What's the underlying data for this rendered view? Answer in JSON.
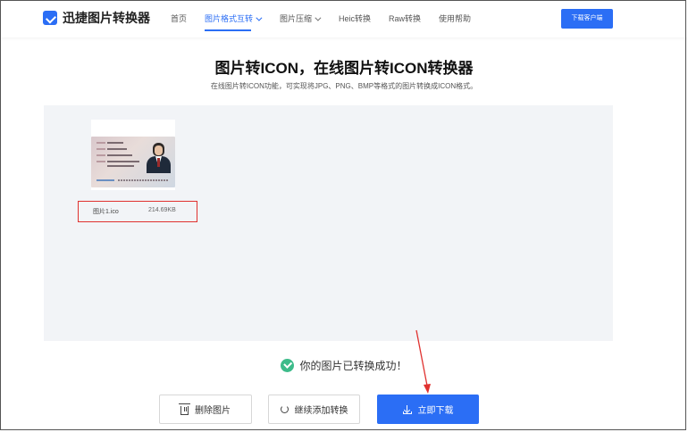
{
  "header": {
    "logo_text": "迅捷图片转换器",
    "nav": [
      {
        "label": "首页"
      },
      {
        "label": "图片格式互转"
      },
      {
        "label": "图片压缩"
      },
      {
        "label": "Heic转换"
      },
      {
        "label": "Raw转换"
      },
      {
        "label": "使用帮助"
      }
    ],
    "download_client": "下载客户端"
  },
  "main": {
    "title": "图片转ICON，在线图片转ICON转换器",
    "subtitle": "在线图片转ICON功能，可实现将JPG、PNG、BMP等格式的图片转换成ICON格式。"
  },
  "preview": {
    "file_name": "图片1.ico",
    "file_size": "214.69KB"
  },
  "status": {
    "success_text": "你的图片已转换成功！"
  },
  "actions": {
    "delete": "删除图片",
    "continue": "继续添加转换",
    "download": "立即下载"
  },
  "colors": {
    "accent": "#2b6ef5",
    "success": "#3dbb8a",
    "highlight": "#e0312f"
  }
}
